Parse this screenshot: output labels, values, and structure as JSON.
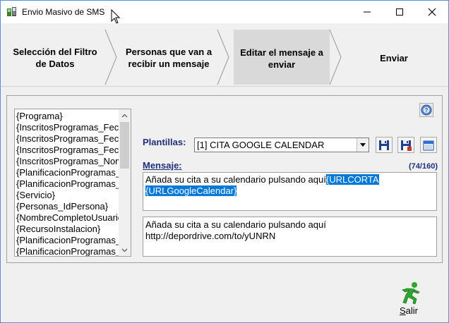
{
  "window": {
    "title": "Envio Masivo de SMS"
  },
  "steps": [
    {
      "line1": "Selección del Filtro",
      "line2": "de Datos"
    },
    {
      "line1": "Personas que van a",
      "line2": "recibir un mensaje"
    },
    {
      "line1": "Editar el mensaje a",
      "line2": "enviar"
    },
    {
      "line1": "Enviar",
      "line2": ""
    }
  ],
  "active_step": 3,
  "fields": [
    "{Programa}",
    "{InscritosProgramas_FechaAlta}",
    "{InscritosProgramas_FechaBaja}",
    "{InscritosProgramas_FechaInicio}",
    "{InscritosProgramas_NombrePrograma}",
    "{PlanificacionProgramas_Dia}",
    "{PlanificacionProgramas_Hora}",
    "{Servicio}",
    "{Personas_IdPersona}",
    "{NombreCompletoUsuario}",
    "{RecursoInstalacion}",
    "{PlanificacionProgramas_Inicio}",
    "{PlanificacionProgramas_Fin}"
  ],
  "plantillas": {
    "label": "Plantillas:",
    "selected": "[1] CITA GOOGLE CALENDAR"
  },
  "mensaje": {
    "label": "Mensaje:",
    "counter": "(74/160)",
    "text_plain": "Añada su cita a su calendario pulsando aquí",
    "text_selected_1": "{URLCORTA",
    "text_selected_2": "{URLGoogleCalendar}"
  },
  "preview": {
    "line1": "Añada su cita a su calendario pulsando aquí",
    "line2": "http://depordrive.com/to/yUNRN"
  },
  "exit": {
    "label_underlined": "S",
    "label_rest": "alir"
  },
  "icons": {
    "app": "app-sms-icon",
    "help": "help-icon",
    "save": "save-icon",
    "save_as": "save-as-icon",
    "calendar": "calendar-icon",
    "exit": "running-man-icon"
  },
  "colors": {
    "label_blue": "#1f2f7a",
    "selection": "#0078d7",
    "active_step_bg": "#d9d9d9"
  }
}
